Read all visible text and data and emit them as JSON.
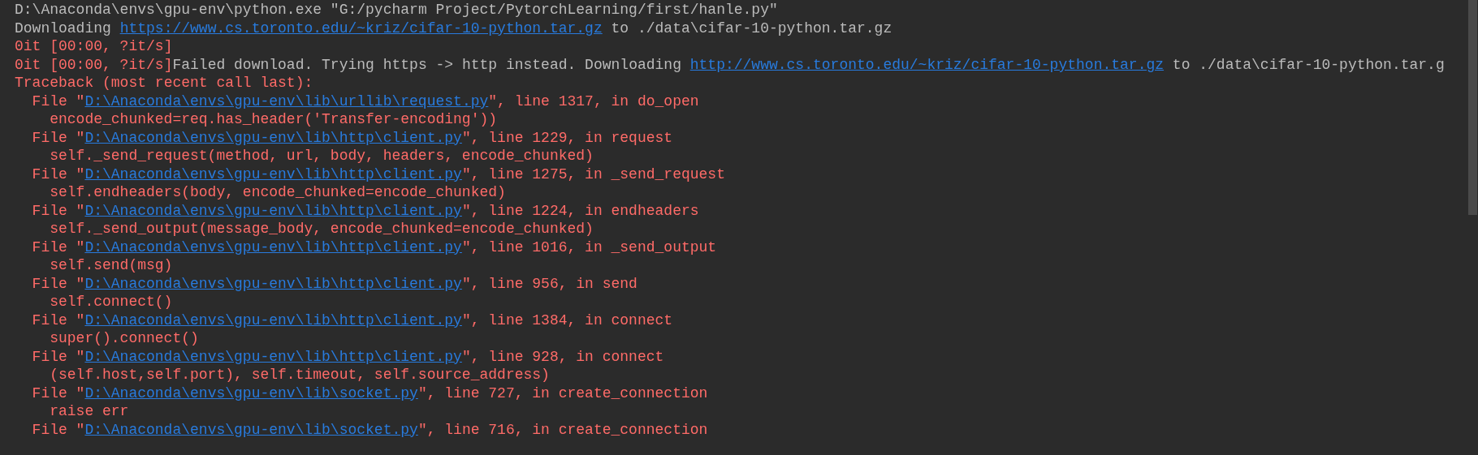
{
  "console": {
    "lines": [
      {
        "kind": "output",
        "segments": [
          {
            "kind": "plain",
            "text": "D:\\Anaconda\\envs\\gpu-env\\python.exe \"G:/pycharm Project/PytorchLearning/first/hanle.py\""
          }
        ]
      },
      {
        "kind": "output",
        "segments": [
          {
            "kind": "plain",
            "text": "Downloading "
          },
          {
            "kind": "link",
            "text": "https://www.cs.toronto.edu/~kriz/cifar-10-python.tar.gz"
          },
          {
            "kind": "plain",
            "text": " to ./data\\cifar-10-python.tar.gz"
          }
        ]
      },
      {
        "kind": "output",
        "segments": [
          {
            "kind": "error",
            "text": "0it [00:00, ?it/s]"
          }
        ]
      },
      {
        "kind": "output",
        "segments": [
          {
            "kind": "error",
            "text": "0it [00:00, ?it/s]"
          },
          {
            "kind": "plain",
            "text": "Failed download. Trying https -> http instead. Downloading "
          },
          {
            "kind": "link",
            "text": "http://www.cs.toronto.edu/~kriz/cifar-10-python.tar.gz"
          },
          {
            "kind": "plain",
            "text": " to ./data\\cifar-10-python.tar.g"
          }
        ]
      },
      {
        "kind": "output",
        "segments": [
          {
            "kind": "error",
            "text": "Traceback (most recent call last):"
          }
        ]
      },
      {
        "kind": "frame",
        "segments": [
          {
            "kind": "error",
            "text": "File \""
          },
          {
            "kind": "link",
            "text": "D:\\Anaconda\\envs\\gpu-env\\lib\\urllib\\request.py"
          },
          {
            "kind": "error",
            "text": "\", line 1317, in do_open"
          }
        ]
      },
      {
        "kind": "source",
        "segments": [
          {
            "kind": "error",
            "text": "encode_chunked=req.has_header('Transfer-encoding'))"
          }
        ]
      },
      {
        "kind": "frame",
        "segments": [
          {
            "kind": "error",
            "text": "File \""
          },
          {
            "kind": "link",
            "text": "D:\\Anaconda\\envs\\gpu-env\\lib\\http\\client.py"
          },
          {
            "kind": "error",
            "text": "\", line 1229, in request"
          }
        ]
      },
      {
        "kind": "source",
        "segments": [
          {
            "kind": "error",
            "text": "self._send_request(method, url, body, headers, encode_chunked)"
          }
        ]
      },
      {
        "kind": "frame",
        "segments": [
          {
            "kind": "error",
            "text": "File \""
          },
          {
            "kind": "link",
            "text": "D:\\Anaconda\\envs\\gpu-env\\lib\\http\\client.py"
          },
          {
            "kind": "error",
            "text": "\", line 1275, in _send_request"
          }
        ]
      },
      {
        "kind": "source",
        "segments": [
          {
            "kind": "error",
            "text": "self.endheaders(body, encode_chunked=encode_chunked)"
          }
        ]
      },
      {
        "kind": "frame",
        "segments": [
          {
            "kind": "error",
            "text": "File \""
          },
          {
            "kind": "link",
            "text": "D:\\Anaconda\\envs\\gpu-env\\lib\\http\\client.py"
          },
          {
            "kind": "error",
            "text": "\", line 1224, in endheaders"
          }
        ]
      },
      {
        "kind": "source",
        "segments": [
          {
            "kind": "error",
            "text": "self._send_output(message_body, encode_chunked=encode_chunked)"
          }
        ]
      },
      {
        "kind": "frame",
        "segments": [
          {
            "kind": "error",
            "text": "File \""
          },
          {
            "kind": "link",
            "text": "D:\\Anaconda\\envs\\gpu-env\\lib\\http\\client.py"
          },
          {
            "kind": "error",
            "text": "\", line 1016, in _send_output"
          }
        ]
      },
      {
        "kind": "source",
        "segments": [
          {
            "kind": "error",
            "text": "self.send(msg)"
          }
        ]
      },
      {
        "kind": "frame",
        "segments": [
          {
            "kind": "error",
            "text": "File \""
          },
          {
            "kind": "link",
            "text": "D:\\Anaconda\\envs\\gpu-env\\lib\\http\\client.py"
          },
          {
            "kind": "error",
            "text": "\", line 956, in send"
          }
        ]
      },
      {
        "kind": "source",
        "segments": [
          {
            "kind": "error",
            "text": "self.connect()"
          }
        ]
      },
      {
        "kind": "frame",
        "segments": [
          {
            "kind": "error",
            "text": "File \""
          },
          {
            "kind": "link",
            "text": "D:\\Anaconda\\envs\\gpu-env\\lib\\http\\client.py"
          },
          {
            "kind": "error",
            "text": "\", line 1384, in connect"
          }
        ]
      },
      {
        "kind": "source",
        "segments": [
          {
            "kind": "error",
            "text": "super().connect()"
          }
        ]
      },
      {
        "kind": "frame",
        "segments": [
          {
            "kind": "error",
            "text": "File \""
          },
          {
            "kind": "link",
            "text": "D:\\Anaconda\\envs\\gpu-env\\lib\\http\\client.py"
          },
          {
            "kind": "error",
            "text": "\", line 928, in connect"
          }
        ]
      },
      {
        "kind": "source",
        "segments": [
          {
            "kind": "error",
            "text": "(self.host,self.port), self.timeout, self.source_address)"
          }
        ]
      },
      {
        "kind": "frame",
        "segments": [
          {
            "kind": "error",
            "text": "File \""
          },
          {
            "kind": "link",
            "text": "D:\\Anaconda\\envs\\gpu-env\\lib\\socket.py"
          },
          {
            "kind": "error",
            "text": "\", line 727, in create_connection"
          }
        ]
      },
      {
        "kind": "source",
        "segments": [
          {
            "kind": "error",
            "text": "raise err"
          }
        ]
      },
      {
        "kind": "frame",
        "segments": [
          {
            "kind": "error",
            "text": "File \""
          },
          {
            "kind": "link",
            "text": "D:\\Anaconda\\envs\\gpu-env\\lib\\socket.py"
          },
          {
            "kind": "error",
            "text": "\", line 716, in create_connection"
          }
        ]
      }
    ]
  }
}
